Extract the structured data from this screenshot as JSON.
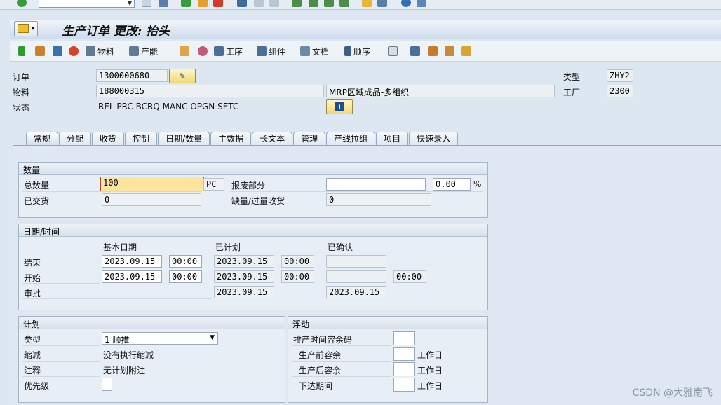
{
  "title": "生产订单 更改: 抬头",
  "toolbar": {
    "material_label": "物料",
    "capacity_label": "产能",
    "operation_label": "工序",
    "component_label": "组件",
    "document_label": "文档",
    "sequence_label": "顺序"
  },
  "header": {
    "order_label": "订单",
    "order_value": "1300000680",
    "material_label": "物料",
    "material_value": "188000315",
    "material_desc": "MRP区域成品-多组织",
    "status_label": "状态",
    "status_value": "REL  PRC  BCRQ MANC OPGN SETC",
    "type_label": "类型",
    "type_value": "ZHY2",
    "plant_label": "工厂",
    "plant_value": "2300"
  },
  "tabs": [
    "常规",
    "分配",
    "收货",
    "控制",
    "日期/数量",
    "主数据",
    "长文本",
    "管理",
    "产线拉组",
    "项目",
    "快速录入"
  ],
  "quantity": {
    "header": "数量",
    "total_label": "总数量",
    "total_value": "100",
    "unit": "PC",
    "delivered_label": "已交货",
    "delivered_value": "0",
    "scrap_label": "报废部分",
    "scrap_value": "",
    "scrap_pct": "0.00",
    "pct_sign": "%",
    "short_label": "缺量/过量收货",
    "short_value": "0"
  },
  "dates": {
    "header": "日期/时间",
    "col_basic": "基本日期",
    "col_scheduled": "已计划",
    "col_confirmed": "已确认",
    "end_label": "结束",
    "start_label": "开始",
    "release_label": "审批",
    "end_basic_date": "2023.09.15",
    "end_basic_time": "00:00",
    "end_sched_date": "2023.09.15",
    "end_sched_time": "00:00",
    "start_basic_date": "2023.09.15",
    "start_basic_time": "00:00",
    "start_sched_date": "2023.09.15",
    "start_sched_time": "00:00",
    "start_conf_time": "00:00",
    "release_sched_date": "2023.09.15",
    "release_conf_date": "2023.09.15"
  },
  "plan": {
    "header": "计划",
    "type_label": "类型",
    "type_value": "1 顺推",
    "reduction_label": "缩减",
    "reduction_value": "没有执行缩减",
    "note_label": "注释",
    "note_value": "无计划附注",
    "priority_label": "优先级"
  },
  "float": {
    "header": "浮动",
    "margin_key_label": "排产时间容余码",
    "before_label": "生产前容余",
    "after_label": "生产后容余",
    "release_label": "下达期间",
    "workday": "工作日"
  },
  "watermark": "CSDN @大雅南飞"
}
